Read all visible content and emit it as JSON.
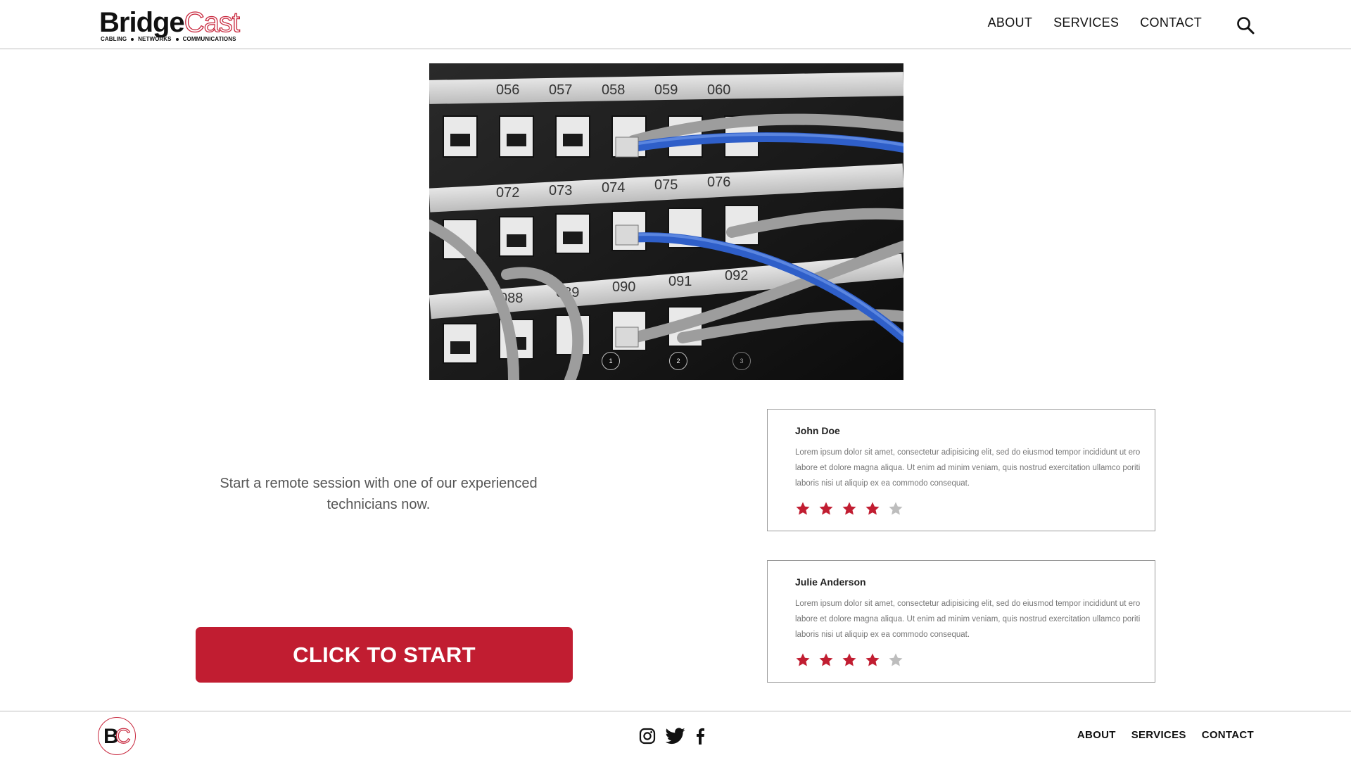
{
  "header": {
    "logo": {
      "part1": "Bridge",
      "part2": "Cast",
      "tagline": [
        "CABLING",
        "NETWORKS",
        "COMMUNICATIONS"
      ]
    },
    "nav": [
      "ABOUT",
      "SERVICES",
      "CONTACT"
    ],
    "search_icon": "search-icon"
  },
  "hero": {
    "port_labels": [
      "056",
      "057",
      "058",
      "059",
      "060",
      "072",
      "073",
      "074",
      "075",
      "076",
      "088",
      "089",
      "090",
      "091",
      "092"
    ],
    "slider_dots": [
      "1",
      "2",
      "3"
    ]
  },
  "main": {
    "intro": "Start a remote session with one of our experienced technicians now.",
    "cta_label": "CLICK TO START"
  },
  "reviews": [
    {
      "name": "John Doe",
      "text": "Lorem ipsum dolor sit amet, consectetur adipisicing elit, sed do eiusmod tempor incididunt ut ero labore et dolore magna aliqua. Ut enim ad minim veniam, quis nostrud exercitation ullamco poriti laboris nisi ut aliquip ex ea commodo consequat.",
      "rating": 4,
      "max_rating": 5
    },
    {
      "name": "Julie Anderson",
      "text": "Lorem ipsum dolor sit amet, consectetur adipisicing elit, sed do eiusmod tempor incididunt ut ero labore et dolore magna aliqua. Ut enim ad minim veniam, quis nostrud exercitation ullamco poriti laboris nisi ut aliquip ex ea commodo consequat.",
      "rating": 4,
      "max_rating": 5
    }
  ],
  "footer": {
    "logo": {
      "b": "B",
      "c": "C"
    },
    "social_icons": [
      "instagram-icon",
      "twitter-icon",
      "facebook-icon"
    ],
    "nav": [
      "ABOUT",
      "SERVICES",
      "CONTACT"
    ]
  },
  "colors": {
    "accent": "#c11d31",
    "star_active": "#c11d31",
    "star_inactive": "#bdbdbd"
  }
}
